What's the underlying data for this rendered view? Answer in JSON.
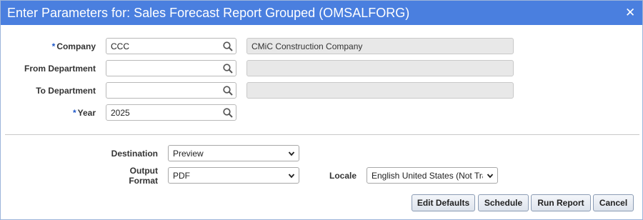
{
  "window": {
    "title": "Enter Parameters for: Sales Forecast Report Grouped (OMSALFORG)",
    "close_glyph": "✕"
  },
  "form": {
    "required_marker": "*",
    "company": {
      "label": "Company",
      "required": true,
      "value": "CCC",
      "description": "CMiC Construction Company"
    },
    "from_department": {
      "label": "From Department",
      "required": false,
      "value": "",
      "description": ""
    },
    "to_department": {
      "label": "To Department",
      "required": false,
      "value": "",
      "description": ""
    },
    "year": {
      "label": "Year",
      "required": true,
      "value": "2025"
    },
    "destination": {
      "label": "Destination",
      "selected": "Preview"
    },
    "output_format": {
      "label_line1": "Output",
      "label_line2": "Format",
      "selected": "PDF"
    },
    "locale": {
      "label": "Locale",
      "selected": "English United States (Not Translated)"
    }
  },
  "buttons": {
    "edit_defaults": "Edit Defaults",
    "schedule": "Schedule",
    "run_report": "Run Report",
    "cancel": "Cancel"
  },
  "icons": {
    "lookup": "magnifier-icon",
    "dropdown": "chevron-down-icon",
    "close": "close-icon"
  },
  "colors": {
    "titlebar": "#4a7fdf",
    "required": "#1f58c9",
    "readonly_field": "#e8e8e8"
  }
}
